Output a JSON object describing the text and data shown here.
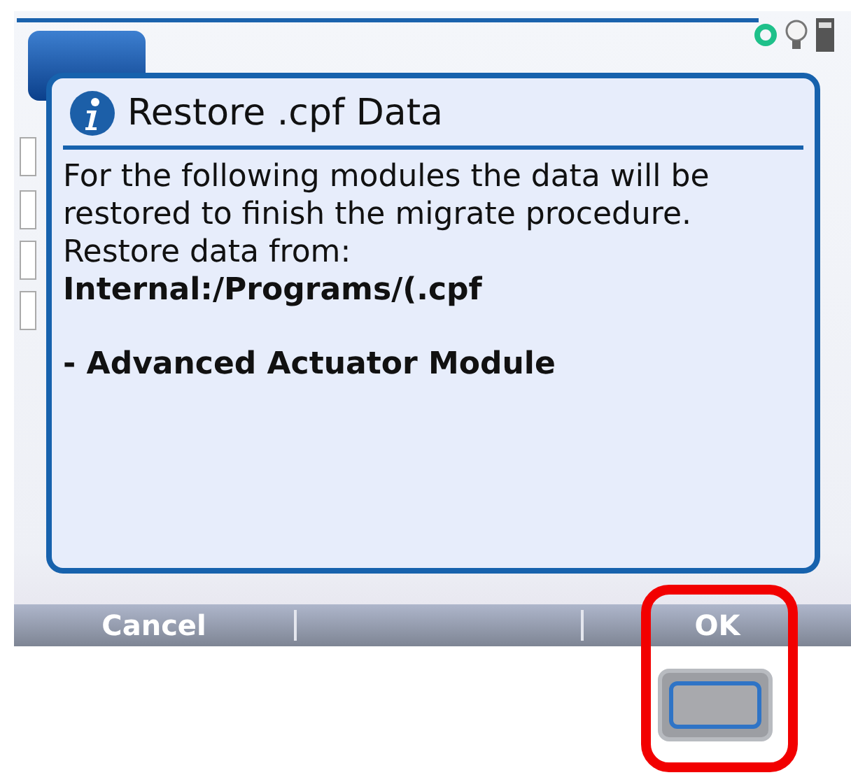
{
  "dialog": {
    "title": "Restore .cpf Data",
    "message": "For the following modules the data will be restored to finish the migrate procedure.",
    "source_label": "Restore data from:",
    "source_path": "Internal:/Programs/(.cpf",
    "modules": [
      "- Advanced Actuator Module"
    ]
  },
  "softkeys": [
    "Cancel",
    "OK"
  ]
}
